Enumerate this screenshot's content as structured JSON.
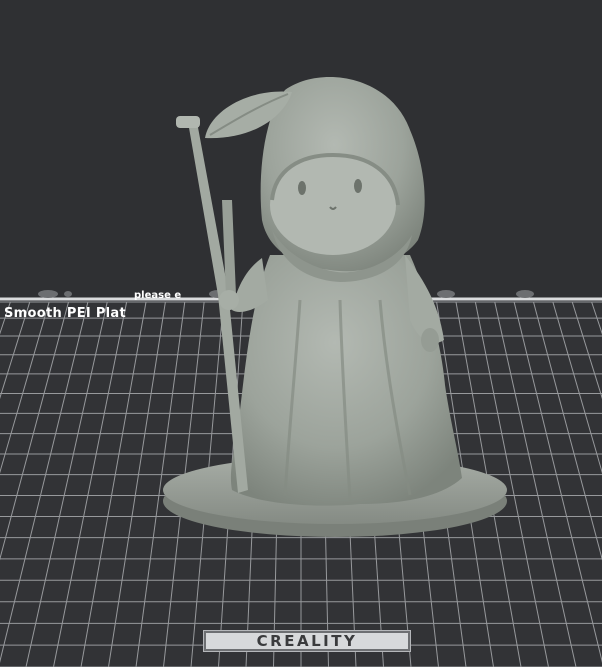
{
  "viewport": {
    "background_color": "#2f3033",
    "bed_color": "#323336",
    "grid_color": "#a9abae",
    "model_color": "#9ea59d"
  },
  "build_plate": {
    "top_text": "please e",
    "plate_name": "Smooth PEI Plat",
    "brand": "CREALITY"
  },
  "model": {
    "description_icon": "hooded-reaper-figure-with-staff"
  }
}
